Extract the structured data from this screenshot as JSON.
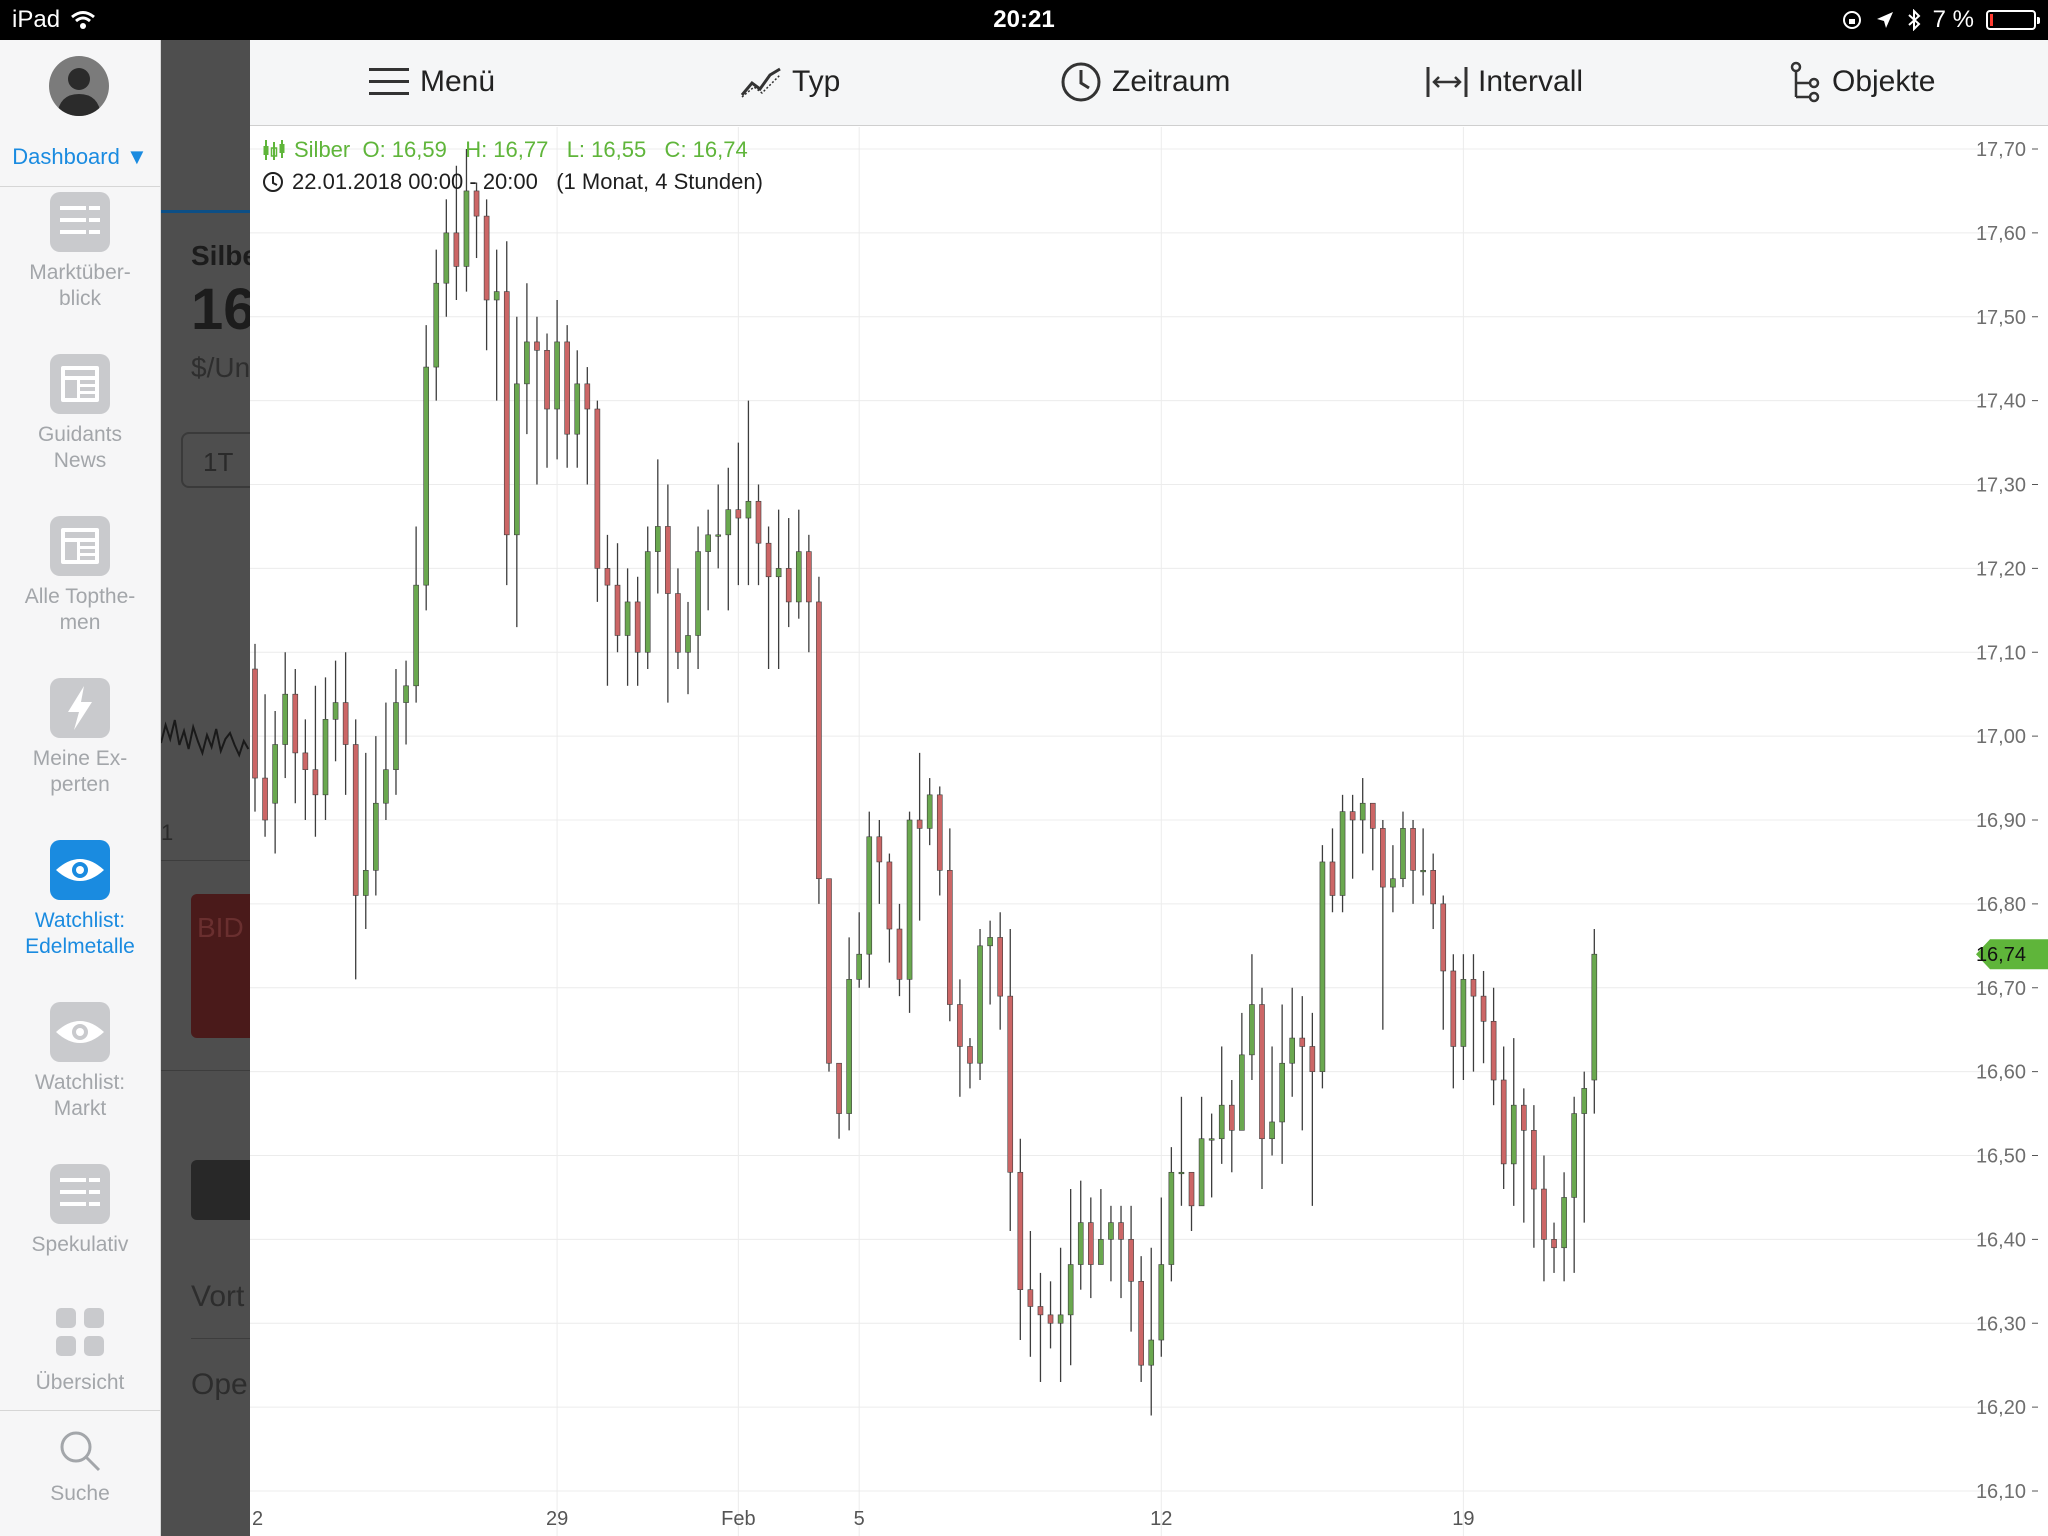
{
  "status_bar": {
    "device": "iPad",
    "time": "20:21",
    "battery": "7 %",
    "battery_fraction": 0.07
  },
  "sidebar": {
    "dashboard_label": "Dashboard",
    "items": [
      {
        "label_line1": "Marktüber-",
        "label_line2": "blick",
        "icon": "list-icon",
        "active": false
      },
      {
        "label_line1": "Guidants",
        "label_line2": "News",
        "icon": "news-icon",
        "active": false
      },
      {
        "label_line1": "Alle Topthe-",
        "label_line2": "men",
        "icon": "news-icon",
        "active": false
      },
      {
        "label_line1": "Meine Ex-",
        "label_line2": "perten",
        "icon": "lightning-icon",
        "active": false
      },
      {
        "label_line1": "Watchlist:",
        "label_line2": "Edelmetalle",
        "icon": "eye-icon",
        "active": true
      },
      {
        "label_line1": "Watchlist:",
        "label_line2": "Markt",
        "icon": "eye-icon",
        "active": false
      },
      {
        "label_line1": "Spekulativ",
        "label_line2": "",
        "icon": "list-icon",
        "active": false
      },
      {
        "label_line1": "Übersicht",
        "label_line2": "",
        "icon": "grid-icon",
        "active": false
      }
    ],
    "search_label": "Suche"
  },
  "background_panel": {
    "title": "Silbe",
    "price": "16",
    "unit": "$/Un",
    "range_button": "1T",
    "bid": "BID",
    "vortag": "Vort",
    "open": "Ope",
    "side_number": "1"
  },
  "toolbar": {
    "menu": "Menü",
    "type": "Typ",
    "period": "Zeitraum",
    "interval": "Intervall",
    "objects": "Objekte"
  },
  "legend": {
    "ohlc_text": "Silber  O: 16,59   H: 16,77   L: 16,55   C: 16,74",
    "range_text": "22.01.2018 00:00 - 20:00   (1 Monat, 4 Stunden)"
  },
  "colors": {
    "up": "#6aa84f",
    "down": "#cc6666",
    "legend": "#5fb53a",
    "accent": "#1a8be0",
    "last_price_bg": "#5fb53a"
  },
  "chart_data": {
    "type": "candlestick",
    "instrument": "Silber",
    "ylim": [
      16.08,
      17.74
    ],
    "y_ticks": [
      16.1,
      16.2,
      16.3,
      16.4,
      16.5,
      16.6,
      16.7,
      16.8,
      16.9,
      17.0,
      17.1,
      17.2,
      17.3,
      17.4,
      17.5,
      17.6,
      17.7
    ],
    "y_tick_labels": [
      "16,10",
      "16,20",
      "16,30",
      "16,40",
      "16,50",
      "16,60",
      "16,70",
      "16,80",
      "16,90",
      "17,00",
      "17,10",
      "17,20",
      "17,30",
      "17,40",
      "17,50",
      "17,60",
      "17,70"
    ],
    "x_ticks": [
      {
        "label": "2",
        "index": 0
      },
      {
        "label": "29",
        "index": 30
      },
      {
        "label": "Feb",
        "index": 48
      },
      {
        "label": "5",
        "index": 60
      },
      {
        "label": "12",
        "index": 90
      },
      {
        "label": "19",
        "index": 120
      }
    ],
    "last_price": 16.74,
    "last_price_label": "16,74",
    "candles": [
      [
        17.08,
        16.95,
        17.11,
        16.91
      ],
      [
        16.95,
        16.9,
        17.05,
        16.88
      ],
      [
        16.92,
        16.99,
        17.03,
        16.86
      ],
      [
        16.99,
        17.05,
        17.1,
        16.95
      ],
      [
        17.05,
        16.98,
        17.08,
        16.92
      ],
      [
        16.98,
        16.96,
        17.02,
        16.9
      ],
      [
        16.96,
        16.93,
        17.06,
        16.88
      ],
      [
        16.93,
        17.02,
        17.07,
        16.9
      ],
      [
        17.02,
        17.04,
        17.09,
        16.97
      ],
      [
        17.04,
        16.99,
        17.1,
        16.93
      ],
      [
        16.99,
        16.81,
        17.02,
        16.71
      ],
      [
        16.81,
        16.84,
        16.98,
        16.77
      ],
      [
        16.84,
        16.92,
        17.0,
        16.81
      ],
      [
        16.92,
        16.96,
        17.04,
        16.9
      ],
      [
        16.96,
        17.04,
        17.08,
        16.93
      ],
      [
        17.04,
        17.06,
        17.09,
        16.99
      ],
      [
        17.06,
        17.18,
        17.25,
        17.04
      ],
      [
        17.18,
        17.44,
        17.49,
        17.15
      ],
      [
        17.44,
        17.54,
        17.58,
        17.4
      ],
      [
        17.54,
        17.6,
        17.64,
        17.5
      ],
      [
        17.6,
        17.56,
        17.68,
        17.52
      ],
      [
        17.56,
        17.65,
        17.7,
        17.53
      ],
      [
        17.65,
        17.62,
        17.66,
        17.57
      ],
      [
        17.62,
        17.52,
        17.64,
        17.46
      ],
      [
        17.52,
        17.53,
        17.58,
        17.4
      ],
      [
        17.53,
        17.24,
        17.59,
        17.18
      ],
      [
        17.24,
        17.42,
        17.5,
        17.13
      ],
      [
        17.42,
        17.47,
        17.54,
        17.36
      ],
      [
        17.47,
        17.46,
        17.5,
        17.3
      ],
      [
        17.46,
        17.39,
        17.48,
        17.32
      ],
      [
        17.39,
        17.47,
        17.52,
        17.33
      ],
      [
        17.47,
        17.36,
        17.49,
        17.32
      ],
      [
        17.36,
        17.42,
        17.46,
        17.32
      ],
      [
        17.42,
        17.39,
        17.44,
        17.3
      ],
      [
        17.39,
        17.2,
        17.4,
        17.16
      ],
      [
        17.2,
        17.18,
        17.24,
        17.06
      ],
      [
        17.18,
        17.12,
        17.23,
        17.1
      ],
      [
        17.12,
        17.16,
        17.2,
        17.06
      ],
      [
        17.16,
        17.1,
        17.19,
        17.06
      ],
      [
        17.1,
        17.22,
        17.25,
        17.08
      ],
      [
        17.22,
        17.25,
        17.33,
        17.17
      ],
      [
        17.25,
        17.17,
        17.3,
        17.04
      ],
      [
        17.17,
        17.1,
        17.2,
        17.08
      ],
      [
        17.1,
        17.12,
        17.16,
        17.05
      ],
      [
        17.12,
        17.22,
        17.25,
        17.08
      ],
      [
        17.22,
        17.24,
        17.27,
        17.15
      ],
      [
        17.24,
        17.24,
        17.3,
        17.2
      ],
      [
        17.24,
        17.27,
        17.32,
        17.15
      ],
      [
        17.27,
        17.26,
        17.35,
        17.18
      ],
      [
        17.26,
        17.28,
        17.4,
        17.18
      ],
      [
        17.28,
        17.23,
        17.3,
        17.18
      ],
      [
        17.23,
        17.19,
        17.25,
        17.08
      ],
      [
        17.19,
        17.2,
        17.27,
        17.08
      ],
      [
        17.2,
        17.16,
        17.26,
        17.13
      ],
      [
        17.16,
        17.22,
        17.27,
        17.14
      ],
      [
        17.22,
        17.16,
        17.24,
        17.1
      ],
      [
        17.16,
        16.83,
        17.19,
        16.8
      ],
      [
        16.83,
        16.61,
        16.8,
        16.6
      ],
      [
        16.61,
        16.55,
        16.6,
        16.52
      ],
      [
        16.55,
        16.71,
        16.76,
        16.53
      ],
      [
        16.71,
        16.74,
        16.79,
        16.7
      ],
      [
        16.74,
        16.88,
        16.91,
        16.7
      ],
      [
        16.88,
        16.85,
        16.9,
        16.8
      ],
      [
        16.85,
        16.77,
        16.86,
        16.73
      ],
      [
        16.77,
        16.71,
        16.8,
        16.69
      ],
      [
        16.71,
        16.9,
        16.91,
        16.67
      ],
      [
        16.9,
        16.89,
        16.98,
        16.78
      ],
      [
        16.89,
        16.93,
        16.95,
        16.87
      ],
      [
        16.93,
        16.84,
        16.94,
        16.81
      ],
      [
        16.84,
        16.68,
        16.89,
        16.66
      ],
      [
        16.68,
        16.63,
        16.71,
        16.57
      ],
      [
        16.63,
        16.61,
        16.64,
        16.58
      ],
      [
        16.61,
        16.75,
        16.77,
        16.59
      ],
      [
        16.75,
        16.76,
        16.78,
        16.68
      ],
      [
        16.76,
        16.69,
        16.79,
        16.65
      ],
      [
        16.69,
        16.48,
        16.77,
        16.41
      ],
      [
        16.48,
        16.34,
        16.52,
        16.28
      ],
      [
        16.34,
        16.32,
        16.41,
        16.26
      ],
      [
        16.32,
        16.31,
        16.36,
        16.23
      ],
      [
        16.31,
        16.3,
        16.35,
        16.27
      ],
      [
        16.3,
        16.31,
        16.39,
        16.23
      ],
      [
        16.31,
        16.37,
        16.46,
        16.25
      ],
      [
        16.37,
        16.42,
        16.47,
        16.34
      ],
      [
        16.42,
        16.37,
        16.45,
        16.33
      ],
      [
        16.37,
        16.4,
        16.46,
        16.38
      ],
      [
        16.4,
        16.42,
        16.44,
        16.35
      ],
      [
        16.42,
        16.4,
        16.44,
        16.33
      ],
      [
        16.4,
        16.35,
        16.44,
        16.29
      ],
      [
        16.35,
        16.25,
        16.38,
        16.23
      ],
      [
        16.25,
        16.28,
        16.39,
        16.19
      ],
      [
        16.28,
        16.37,
        16.45,
        16.26
      ],
      [
        16.37,
        16.48,
        16.51,
        16.35
      ],
      [
        16.48,
        16.48,
        16.57,
        16.44
      ],
      [
        16.48,
        16.44,
        16.48,
        16.41
      ],
      [
        16.44,
        16.52,
        16.57,
        16.44
      ],
      [
        16.52,
        16.52,
        16.55,
        16.45
      ],
      [
        16.52,
        16.56,
        16.63,
        16.49
      ],
      [
        16.56,
        16.53,
        16.59,
        16.48
      ],
      [
        16.53,
        16.62,
        16.67,
        16.55
      ],
      [
        16.62,
        16.68,
        16.74,
        16.59
      ],
      [
        16.68,
        16.52,
        16.7,
        16.46
      ],
      [
        16.52,
        16.54,
        16.63,
        16.5
      ],
      [
        16.54,
        16.61,
        16.68,
        16.49
      ],
      [
        16.61,
        16.64,
        16.7,
        16.57
      ],
      [
        16.64,
        16.63,
        16.69,
        16.53
      ],
      [
        16.63,
        16.6,
        16.67,
        16.44
      ],
      [
        16.6,
        16.85,
        16.87,
        16.58
      ],
      [
        16.85,
        16.81,
        16.89,
        16.79
      ],
      [
        16.81,
        16.91,
        16.93,
        16.79
      ],
      [
        16.91,
        16.9,
        16.93,
        16.83
      ],
      [
        16.9,
        16.92,
        16.95,
        16.86
      ],
      [
        16.92,
        16.89,
        16.92,
        16.84
      ],
      [
        16.89,
        16.82,
        16.9,
        16.65
      ],
      [
        16.82,
        16.83,
        16.87,
        16.79
      ],
      [
        16.83,
        16.89,
        16.91,
        16.82
      ],
      [
        16.89,
        16.84,
        16.9,
        16.8
      ],
      [
        16.84,
        16.84,
        16.89,
        16.81
      ],
      [
        16.84,
        16.8,
        16.86,
        16.77
      ],
      [
        16.8,
        16.72,
        16.81,
        16.65
      ],
      [
        16.72,
        16.63,
        16.74,
        16.58
      ],
      [
        16.63,
        16.71,
        16.74,
        16.59
      ],
      [
        16.71,
        16.69,
        16.74,
        16.6
      ],
      [
        16.69,
        16.66,
        16.72,
        16.61
      ],
      [
        16.66,
        16.59,
        16.7,
        16.56
      ],
      [
        16.59,
        16.49,
        16.63,
        16.46
      ],
      [
        16.49,
        16.56,
        16.64,
        16.44
      ],
      [
        16.56,
        16.53,
        16.58,
        16.42
      ],
      [
        16.53,
        16.46,
        16.56,
        16.39
      ],
      [
        16.46,
        16.4,
        16.5,
        16.35
      ],
      [
        16.4,
        16.39,
        16.42,
        16.36
      ],
      [
        16.39,
        16.45,
        16.48,
        16.35
      ],
      [
        16.45,
        16.55,
        16.57,
        16.36
      ],
      [
        16.55,
        16.58,
        16.6,
        16.42
      ],
      [
        16.59,
        16.74,
        16.77,
        16.55
      ]
    ]
  }
}
